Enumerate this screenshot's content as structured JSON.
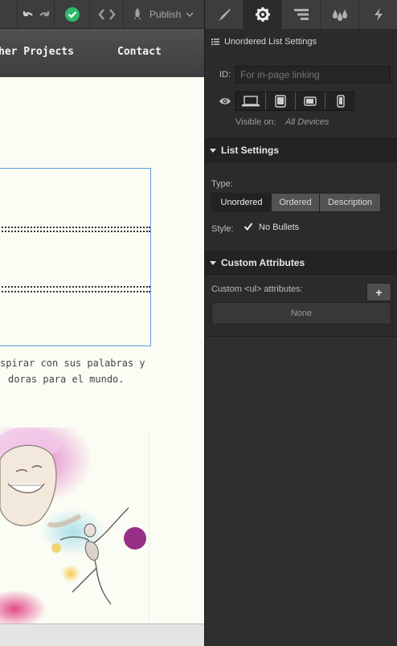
{
  "toolbar": {
    "publish_label": "Publish"
  },
  "canvas": {
    "nav": {
      "link_other_projects": "her Projects",
      "link_contact": "Contact"
    },
    "paragraph_lines": [
      "spirar con sus palabras y",
      "doras para el mundo."
    ]
  },
  "panel": {
    "tabs": [
      "style-tab",
      "settings-tab",
      "navigator-tab",
      "swatches-tab",
      "interactions-tab"
    ],
    "settings_title": "Unordered List Settings",
    "id_label": "ID:",
    "id_placeholder": "For in-page linking",
    "visible_on_label": "Visible on:",
    "visible_on_value": "All Devices",
    "list_settings": {
      "header": "List Settings",
      "type_label": "Type:",
      "type_options": [
        "Unordered",
        "Ordered",
        "Description"
      ],
      "selected_type": "Unordered",
      "style_label": "Style:",
      "no_bullets_label": "No Bullets",
      "no_bullets_checked": true
    },
    "custom_attributes": {
      "header": "Custom Attributes",
      "label": "Custom <ul> attributes:",
      "add_label": "+",
      "empty_label": "None"
    }
  },
  "colors": {
    "accent_green": "#2dba6c",
    "selection_blue": "#5d9fe0",
    "canvas_bg": "#fbfcf4"
  }
}
